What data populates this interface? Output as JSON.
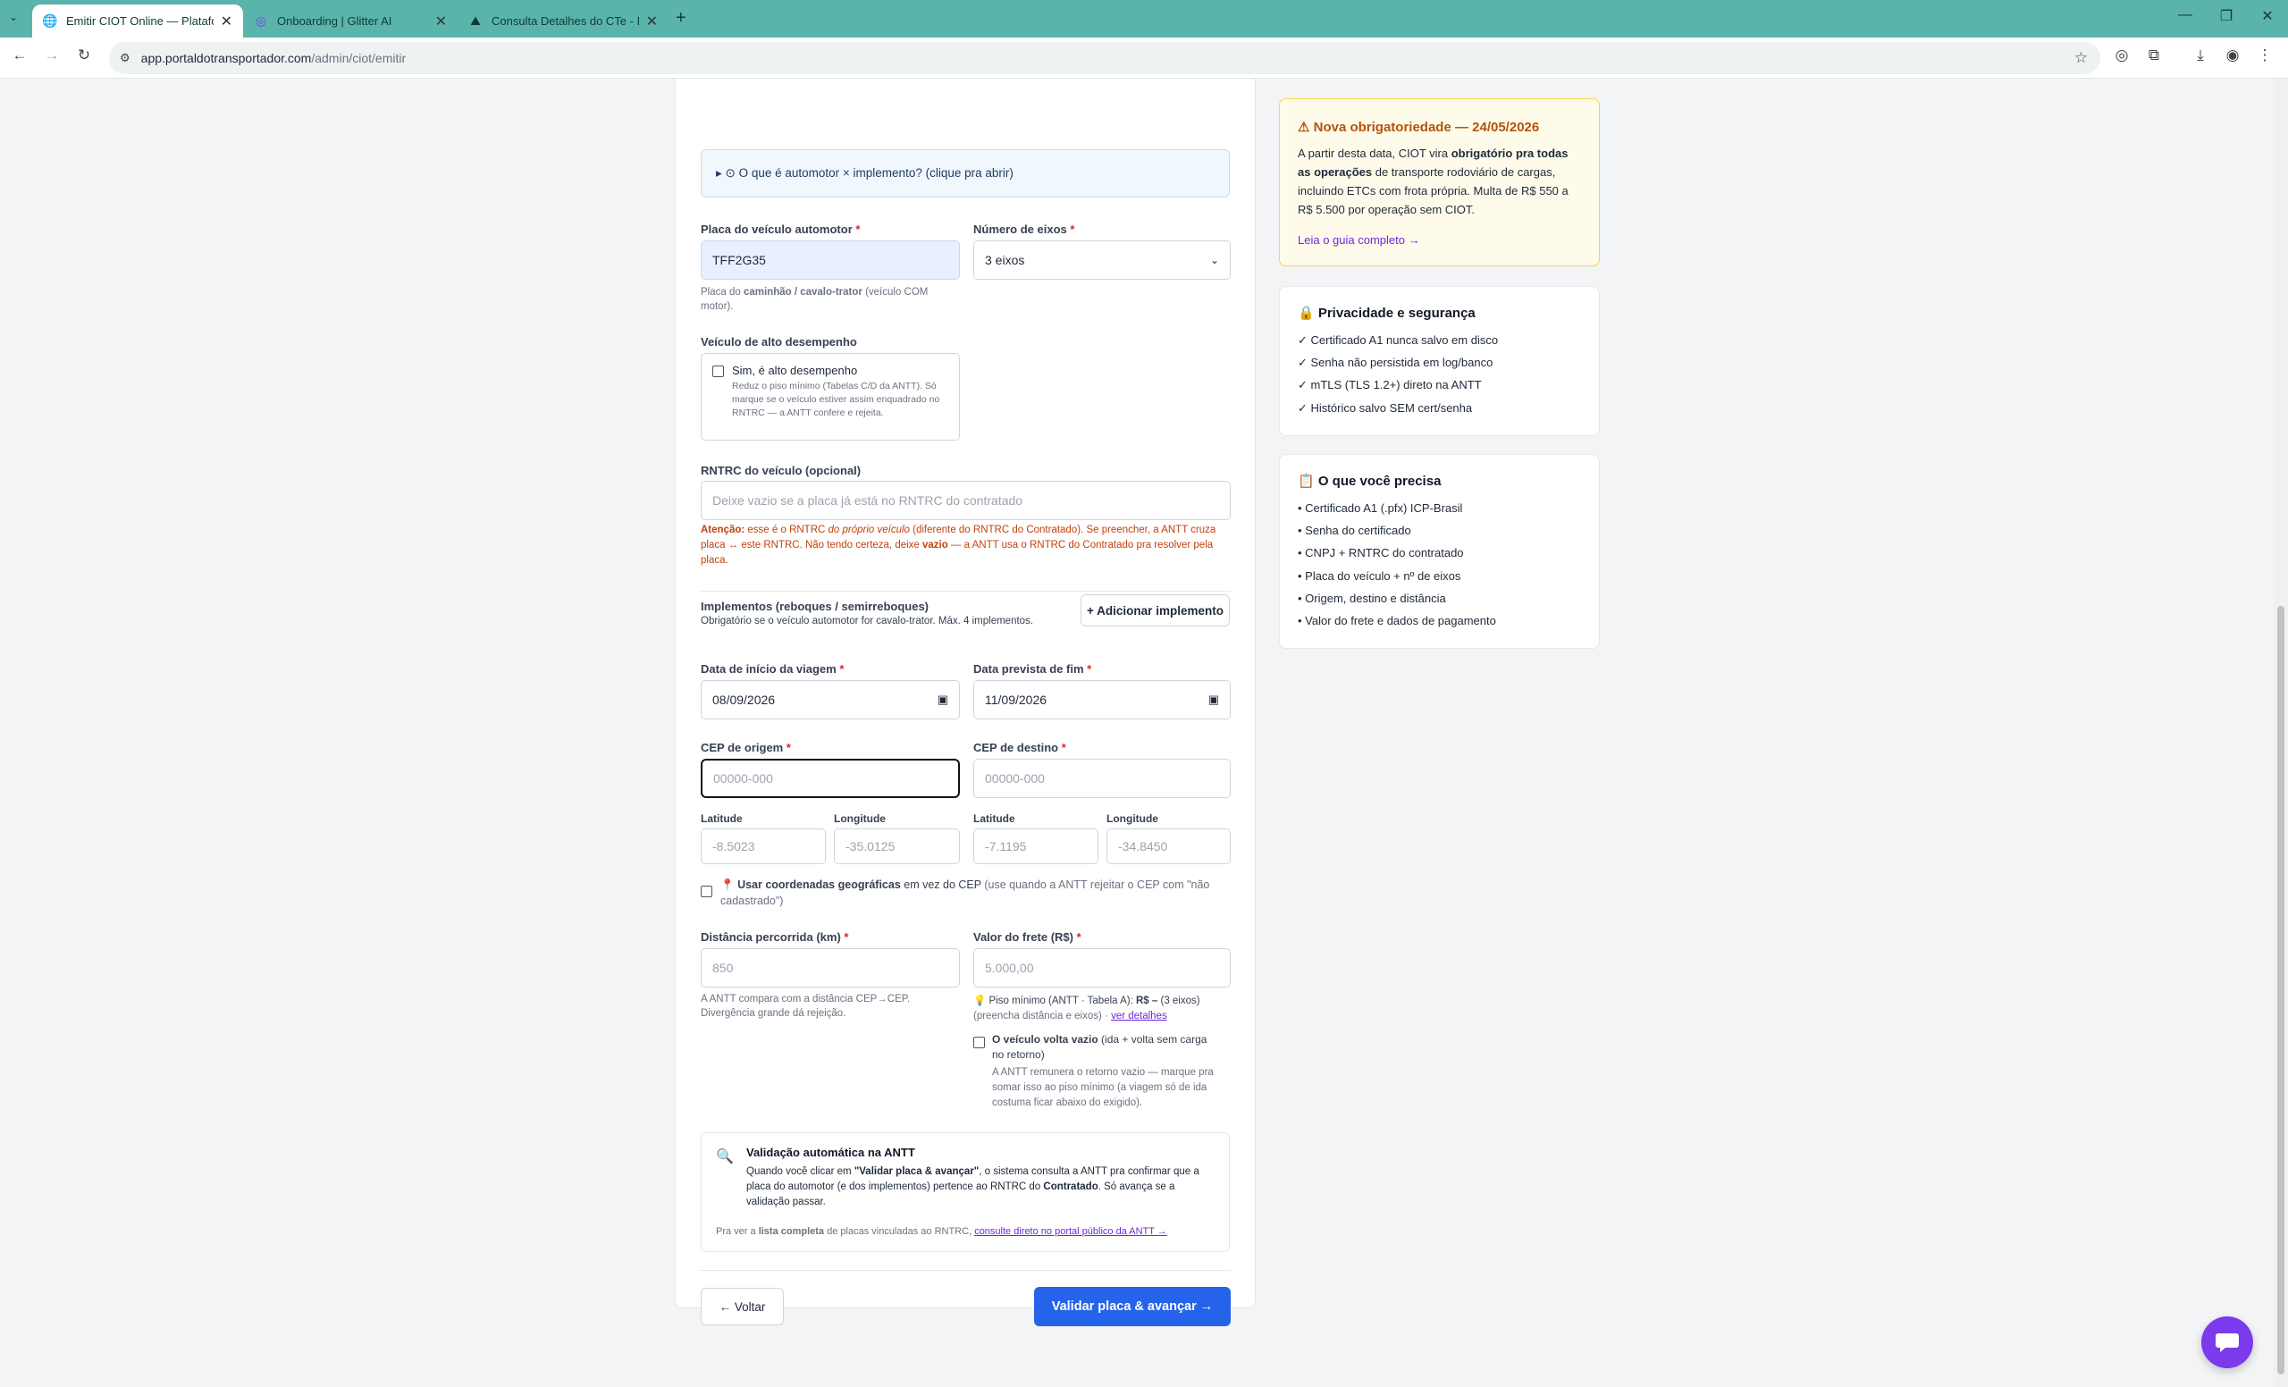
{
  "browser": {
    "tabs": [
      {
        "title": "Emitir CIOT Online — Plataform",
        "icon": "globe-icon",
        "active": true
      },
      {
        "title": "Onboarding | Glitter AI",
        "icon": "glitter-search-icon",
        "active": false
      },
      {
        "title": "Consulta Detalhes do CTe - ERI",
        "icon": "image-icon",
        "active": false
      }
    ],
    "new_tab": "+",
    "url_host": "app.portaldotransportador.com",
    "url_path": "/admin/ciot/emitir"
  },
  "form": {
    "details_summary": "▸ ⊙ O que é automotor × implemento? (clique pra abrir)",
    "plate_label": "Placa do veículo automotor",
    "required_mark": "*",
    "plate_value": "TFF2G35",
    "plate_hint_1": "Placa do ",
    "plate_hint_bold": "caminhão / cavalo-trator",
    "plate_hint_2": " (veículo COM",
    "plate_hint_3": "motor).",
    "axles_label": "Número de eixos",
    "axles_value": "3 eixos",
    "high_perf_label": "Veículo de alto desempenho",
    "high_perf_checkbox": "Sim, é alto desempenho",
    "high_perf_hint": "Reduz o piso mínimo (Tabelas C/D da ANTT). Só marque se o veículo estiver assim enquadrado no RNTRC — a ANTT confere e rejeita.",
    "rntrc_label": "RNTRC do veículo (opcional)",
    "rntrc_placeholder": "Deixe vazio se a placa já está no RNTRC do contratado",
    "attention_bold": "Atenção:",
    "attention_1": " esse é o RNTRC ",
    "attention_italic": "do próprio veículo",
    "attention_2": " (diferente do RNTRC do Contratado). Se preencher, a ANTT cruza placa ↔ este RNTRC. Não tendo certeza, deixe ",
    "attention_bold2": "vazio",
    "attention_3": " — a ANTT usa o RNTRC do Contratado pra resolver pela placa.",
    "implements_label": "Implementos (reboques / semirreboques)",
    "implements_hint": "Obrigatório se o veículo automotor for cavalo-trator. Máx. 4 implementos.",
    "add_implement": "+ Adicionar implemento",
    "start_date_label": "Data de início da viagem",
    "start_date_value": "08/09/2026",
    "end_date_label": "Data prevista de fim",
    "end_date_value": "11/09/2026",
    "cep_origin_label": "CEP de origem",
    "cep_origin_placeholder": "00000-000",
    "cep_dest_label": "CEP de destino",
    "cep_dest_placeholder": "00000-000",
    "lat_label": "Latitude",
    "lon_label": "Longitude",
    "lat_origin_placeholder": "-8.5023",
    "lon_origin_placeholder": "-35.0125",
    "lat_dest_placeholder": "-7.1195",
    "lon_dest_placeholder": "-34.8450",
    "geo_pin": "📍",
    "geo_bold": "Usar coordenadas geográficas",
    "geo_text": " em vez do CEP ",
    "geo_hint": "(use quando a ANTT rejeitar o CEP com \"não",
    "geo_hint_2": "cadastrado\")",
    "distance_label": "Distância percorrida (km)",
    "distance_placeholder": "850",
    "distance_hint_1": "A ANTT compara com a distância CEP→CEP.",
    "distance_hint_2": "Divergência grande dá rejeição.",
    "freight_label": "Valor do frete (R$)",
    "freight_placeholder": "5.000,00",
    "floor_icon": "💡",
    "floor_text_1": "Piso mínimo (ANTT · Tabela A): ",
    "floor_bold": "R$ –",
    "floor_text_2": " (3 eixos)",
    "floor_text_3": "(preencha distância e eixos) · ",
    "floor_link": "ver detalhes",
    "empty_return_bold": "O veículo volta vazio",
    "empty_return_text": " (ida + volta sem carga",
    "empty_return_text_2": "no retorno)",
    "empty_return_hint": "A ANTT remunera o retorno vazio — marque pra somar isso ao piso mínimo (a viagem só de ida costuma ficar abaixo do exigido).",
    "validation_title": "Validação automática na ANTT",
    "validation_1": "Quando você clicar em ",
    "validation_bold": "\"Validar placa & avançar\"",
    "validation_2": ", o sistema consulta a ANTT pra confirmar que a placa do automotor (e dos implementos) pertence ao RNTRC do ",
    "validation_bold2": "Contratado",
    "validation_3": ". Só avança se a validação passar.",
    "validation_footer_1": "Pra ver a ",
    "validation_footer_bold": "lista completa",
    "validation_footer_2": " de placas vinculadas ao RNTRC, ",
    "validation_footer_link": "consulte direto no portal público da ANTT →",
    "back_button": "← Voltar",
    "next_button": "Validar placa & avançar →"
  },
  "sidebar": {
    "notice_title": "⚠ Nova obrigatoriedade — 24/05/2026",
    "notice_1": "A partir desta data, CIOT vira ",
    "notice_bold": "obrigatório pra todas as operações",
    "notice_2": " de transporte rodoviário de cargas, incluindo ETCs com frota própria. Multa de R$ 550 a R$ 5.500 por operação sem CIOT.",
    "notice_link": "Leia o guia completo →",
    "privacy_title": "🔒 Privacidade e segurança",
    "privacy_items": [
      "✓ Certificado A1 nunca salvo em disco",
      "✓ Senha não persistida em log/banco",
      "✓ mTLS (TLS 1.2+) direto na ANTT",
      "✓ Histórico salvo SEM cert/senha"
    ],
    "needs_title": "📋 O que você precisa",
    "needs_items": [
      "• Certificado A1 (.pfx) ICP-Brasil",
      "• Senha do certificado",
      "• CNPJ + RNTRC do contratado",
      "• Placa do veículo + nº de eixos",
      "• Origem, destino e distância",
      "• Valor do frete e dados de pagamento"
    ]
  },
  "colors": {
    "chrome": "#5ab4ac",
    "primary_button": "#2563eb",
    "notice_bg": "#fffbeb",
    "notice_title": "#b45309",
    "chat": "#7c3aed"
  }
}
